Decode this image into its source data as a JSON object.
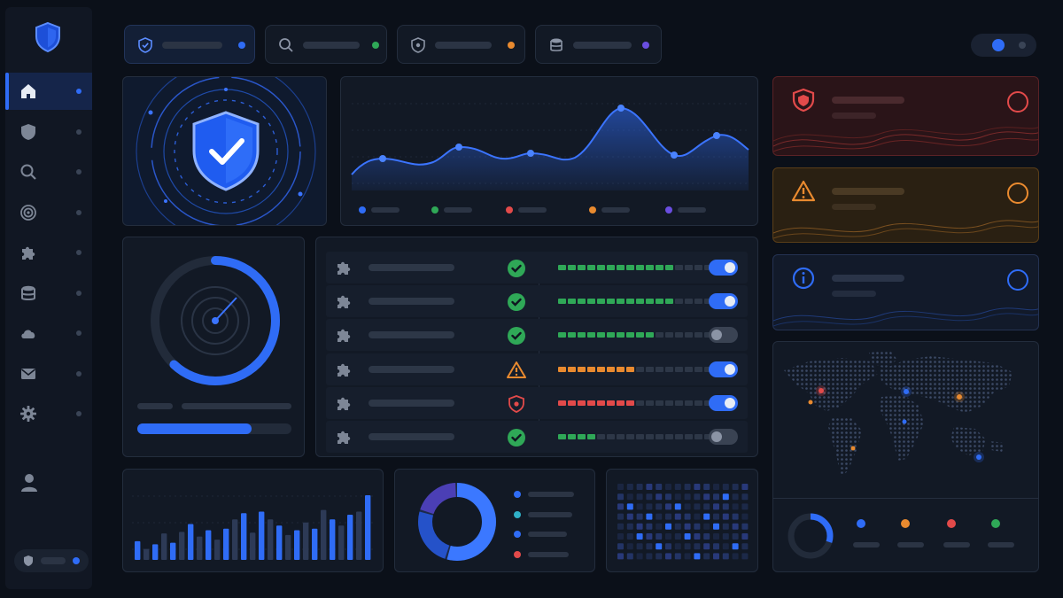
{
  "theme": {
    "accent": "#2f6cf6",
    "background": "#0b1019",
    "panel": "#121925",
    "status_colors": {
      "critical": "#e24a4a",
      "warning": "#e98a2f",
      "info": "#2f6cf6",
      "ok": "#2fa857",
      "purple": "#6a4ee0"
    }
  },
  "sidebar": {
    "logo_icon": "shield-logo-icon",
    "items": [
      {
        "icon": "home-icon",
        "active": true
      },
      {
        "icon": "shield-icon",
        "active": false
      },
      {
        "icon": "search-icon",
        "active": false
      },
      {
        "icon": "target-icon",
        "active": false
      },
      {
        "icon": "puzzle-icon",
        "active": false
      },
      {
        "icon": "database-icon",
        "active": false
      },
      {
        "icon": "cloud-icon",
        "active": false
      },
      {
        "icon": "mail-icon",
        "active": false
      },
      {
        "icon": "gear-icon",
        "active": false
      }
    ],
    "profile_icon": "user-icon",
    "footer_icon": "shield-small-icon"
  },
  "top_tabs": [
    {
      "icon": "shield-check-icon",
      "status": "#2f6cf6",
      "active": true
    },
    {
      "icon": "search-icon",
      "status": "#2fa857",
      "active": false
    },
    {
      "icon": "shield-bug-icon",
      "status": "#e98a2f",
      "active": false
    },
    {
      "icon": "database-icon",
      "status": "#6a4ee0",
      "active": false
    }
  ],
  "header_toggle": {
    "state": "on"
  },
  "hero": {
    "icon": "shield-check-icon"
  },
  "activity_chart": {
    "legend": [
      {
        "color": "#2f6cf6"
      },
      {
        "color": "#2fa857"
      },
      {
        "color": "#e24a4a"
      },
      {
        "color": "#e98a2f"
      },
      {
        "color": "#6a4ee0"
      }
    ]
  },
  "radar_panel": {
    "icon": "radar-icon",
    "ring_progress": 0.62,
    "bar_progress": 0.74
  },
  "modules": [
    {
      "icon": "puzzle-icon",
      "status": "ok",
      "level": 0.75,
      "color": "#2fa857",
      "enabled": true
    },
    {
      "icon": "puzzle-icon",
      "status": "ok",
      "level": 0.75,
      "color": "#2fa857",
      "enabled": true
    },
    {
      "icon": "puzzle-icon",
      "status": "ok",
      "level": 0.625,
      "color": "#2fa857",
      "enabled": false
    },
    {
      "icon": "puzzle-icon",
      "status": "warning",
      "level": 0.5,
      "color": "#e98a2f",
      "enabled": true
    },
    {
      "icon": "puzzle-icon",
      "status": "critical",
      "level": 0.5,
      "color": "#e24a4a",
      "enabled": true
    },
    {
      "icon": "puzzle-icon",
      "status": "ok",
      "level": 0.25,
      "color": "#2fa857",
      "enabled": false
    }
  ],
  "alerts": [
    {
      "icon": "shield-alert-icon",
      "severity": "critical",
      "color": "#e24a4a"
    },
    {
      "icon": "warning-triangle-icon",
      "severity": "warning",
      "color": "#e98a2f"
    },
    {
      "icon": "info-icon",
      "severity": "info",
      "color": "#2f6cf6"
    }
  ],
  "map_panel": {
    "legend": [
      {
        "color": "#2f6cf6"
      },
      {
        "color": "#e98a2f"
      },
      {
        "color": "#e24a4a"
      },
      {
        "color": "#2fa857"
      }
    ],
    "donut_progress": 0.3
  },
  "bar_chart": {
    "values": [
      0.24,
      0.14,
      0.2,
      0.34,
      0.22,
      0.36,
      0.46,
      0.3,
      0.38,
      0.26,
      0.4,
      0.52,
      0.6,
      0.35,
      0.62,
      0.52,
      0.44,
      0.32,
      0.38,
      0.48,
      0.4,
      0.64,
      0.52,
      0.44,
      0.58,
      0.62,
      0.83
    ]
  },
  "donut": {
    "segments": [
      0.55,
      0.25,
      0.2
    ]
  },
  "donut_legend": [
    {
      "color": "#2f6cf6"
    },
    {
      "color": "#2fb0c7"
    },
    {
      "color": "#2f6cf6"
    },
    {
      "color": "#e24a4a"
    }
  ]
}
